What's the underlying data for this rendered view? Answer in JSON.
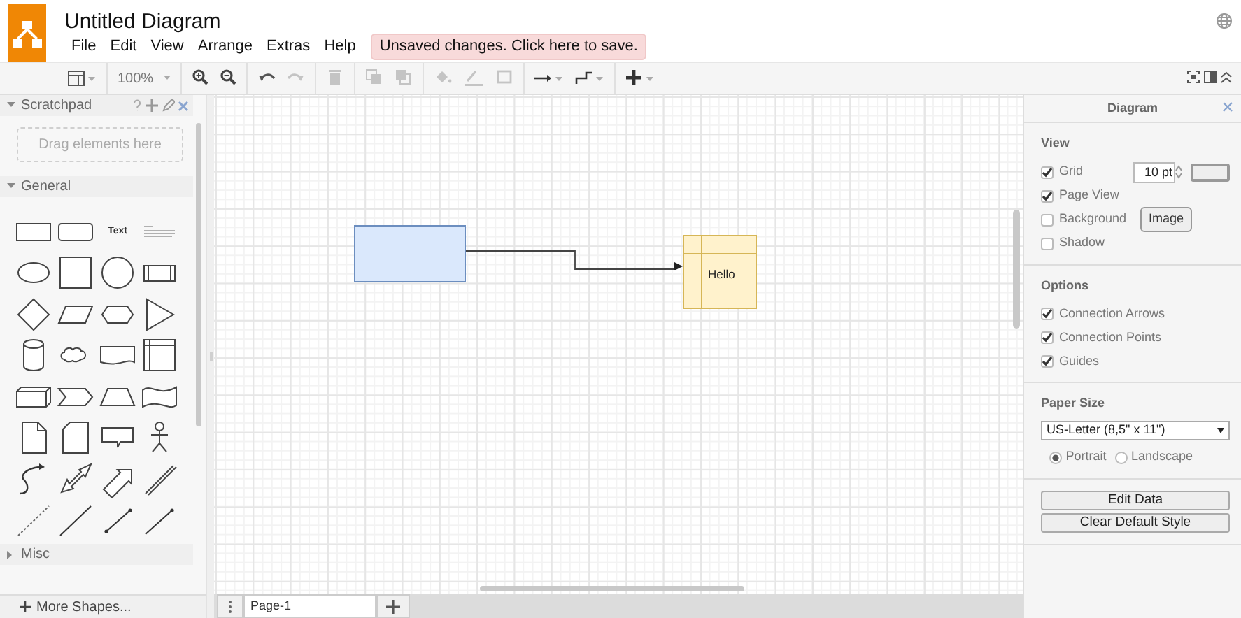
{
  "app": {
    "title": "Untitled Diagram",
    "menu": [
      "File",
      "Edit",
      "View",
      "Arrange",
      "Extras",
      "Help"
    ],
    "save_notice": "Unsaved changes. Click here to save."
  },
  "toolbar": [
    {
      "kind": "format",
      "disabled": false
    },
    {
      "kind": "separator"
    },
    {
      "kind": "zoom",
      "label": "100%",
      "disabled": false
    },
    {
      "kind": "separator"
    },
    {
      "kind": "zoom-in",
      "disabled": false
    },
    {
      "kind": "zoom-out",
      "disabled": false
    },
    {
      "kind": "separator"
    },
    {
      "kind": "undo",
      "disabled": false
    },
    {
      "kind": "redo",
      "disabled": true
    },
    {
      "kind": "separator"
    },
    {
      "kind": "delete",
      "disabled": true
    },
    {
      "kind": "separator"
    },
    {
      "kind": "to-front",
      "disabled": true
    },
    {
      "kind": "to-back",
      "disabled": true
    },
    {
      "kind": "separator"
    },
    {
      "kind": "fill",
      "disabled": true
    },
    {
      "kind": "line",
      "disabled": true
    },
    {
      "kind": "shadow",
      "disabled": true
    },
    {
      "kind": "separator"
    },
    {
      "kind": "connection",
      "disabled": false
    },
    {
      "kind": "waypoints",
      "disabled": false
    },
    {
      "kind": "separator"
    },
    {
      "kind": "insert",
      "disabled": false
    }
  ],
  "sidebar": {
    "sections": [
      {
        "title": "Scratchpad",
        "expanded": true,
        "drop_hint": "Drag elements here"
      },
      {
        "title": "General",
        "expanded": true,
        "text_shape": "Text"
      },
      {
        "title": "Misc",
        "expanded": false
      }
    ],
    "more_shapes": "More Shapes..."
  },
  "canvas": {
    "shapes": [
      {
        "kind": "rect",
        "color": "#dae8fc"
      },
      {
        "kind": "table",
        "color": "#fff2cc",
        "label": "Hello"
      }
    ]
  },
  "page_tabs": [
    {
      "label": "Page-1",
      "selected": true
    }
  ],
  "format_panel": {
    "title": "Diagram",
    "sections": [
      {
        "title": "View",
        "items": [
          {
            "label": "Grid",
            "checked": true,
            "value": "10 pt"
          },
          {
            "label": "Page View",
            "checked": true
          },
          {
            "label": "Background",
            "checked": false,
            "button": "Image"
          },
          {
            "label": "Shadow",
            "checked": false
          }
        ]
      },
      {
        "title": "Options",
        "items": [
          {
            "label": "Connection Arrows",
            "checked": true
          },
          {
            "label": "Connection Points",
            "checked": true
          },
          {
            "label": "Guides",
            "checked": true
          }
        ]
      },
      {
        "title": "Paper Size",
        "select": "US-Letter (8,5\" x 11\")",
        "orientations": [
          {
            "label": "Portrait",
            "selected": true
          },
          {
            "label": "Landscape",
            "selected": false
          }
        ]
      }
    ],
    "buttons": [
      "Edit Data",
      "Clear Default Style"
    ]
  }
}
